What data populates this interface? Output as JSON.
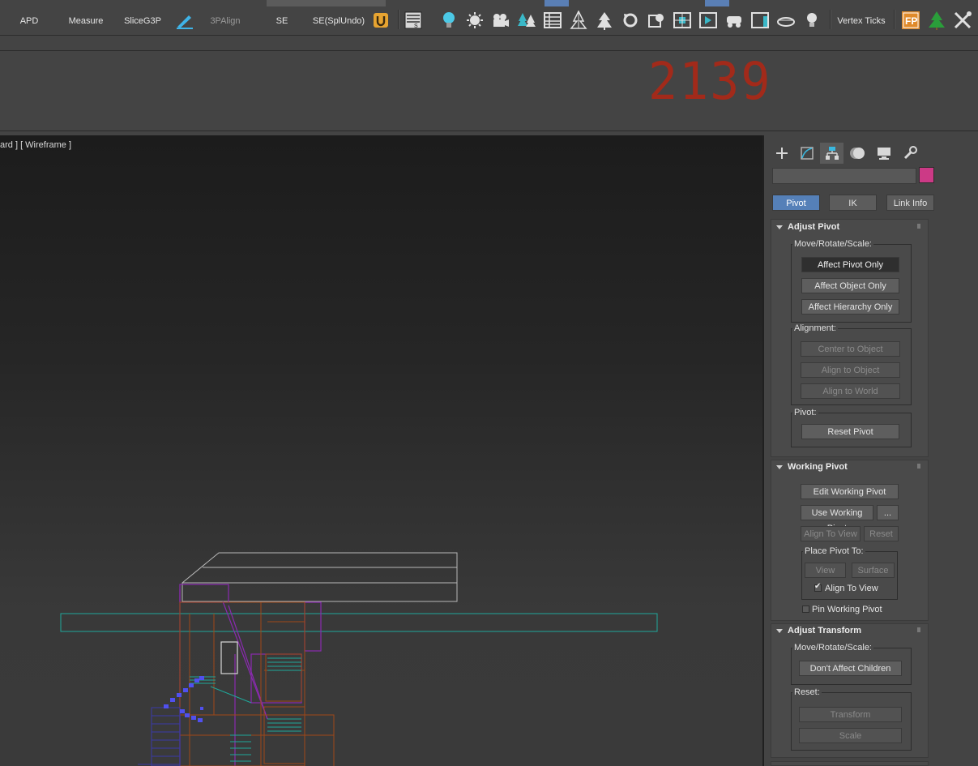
{
  "toolbar": {
    "items": [
      {
        "label": "APD",
        "enabled": true
      },
      {
        "label": "Measure",
        "enabled": true
      },
      {
        "label": "SliceG3P",
        "enabled": true
      },
      {
        "label": "3PAlign",
        "enabled": false
      },
      {
        "label": "SE",
        "enabled": true
      },
      {
        "label": "SE(SplUndo)",
        "enabled": true
      }
    ],
    "vertex_ticks_label": "Vertex Ticks",
    "fp_label": "FP",
    "icons": [
      "paint-icon",
      "u-icon",
      "spreadsheet-icon",
      "light-bulb-icon",
      "sun-icon",
      "camera-icon",
      "trees-icon",
      "table-icon",
      "tree-icon",
      "pine-icon",
      "refresh-icon",
      "cube-icon",
      "cube-render-icon",
      "frame-icon",
      "play-icon",
      "car-icon",
      "window-icon",
      "rubber-duck-icon",
      "bulb-icon",
      "fp-icon",
      "green-tree-icon",
      "tools-icon"
    ]
  },
  "frame_counter": "2139",
  "viewport": {
    "label": "ard ] [ Wireframe ]"
  },
  "command_panel": {
    "tabs": [
      "create-tab",
      "modify-tab",
      "hierarchy-tab",
      "motion-tab",
      "display-tab",
      "utilities-tab"
    ],
    "active_tab": "hierarchy-tab",
    "object_name": "",
    "object_color": "#cc3a86",
    "hierarchy_buttons": {
      "pivot": "Pivot",
      "ik": "IK",
      "link_info": "Link Info"
    },
    "adjust_pivot": {
      "title": "Adjust Pivot",
      "move_group": "Move/Rotate/Scale:",
      "affect_pivot_only": "Affect Pivot Only",
      "affect_object_only": "Affect Object Only",
      "affect_hierarchy_only": "Affect Hierarchy Only",
      "alignment_group": "Alignment:",
      "center_to_object": "Center to Object",
      "align_to_object": "Align to Object",
      "align_to_world": "Align to World",
      "pivot_group": "Pivot:",
      "reset_pivot": "Reset Pivot"
    },
    "working_pivot": {
      "title": "Working Pivot",
      "edit_working_pivot": "Edit Working Pivot",
      "use_working_pivot": "Use Working Pivot",
      "more": "...",
      "align_to_view": "Align To View",
      "reset": "Reset",
      "place_pivot_group": "Place Pivot To:",
      "view": "View",
      "surface": "Surface",
      "align_to_view_check": "Align To View",
      "align_to_view_checked": true,
      "pin_working_pivot": "Pin Working Pivot",
      "pin_checked": false
    },
    "adjust_transform": {
      "title": "Adjust Transform",
      "move_group": "Move/Rotate/Scale:",
      "dont_affect_children": "Don't Affect Children",
      "reset_group": "Reset:",
      "transform": "Transform",
      "scale": "Scale"
    }
  }
}
